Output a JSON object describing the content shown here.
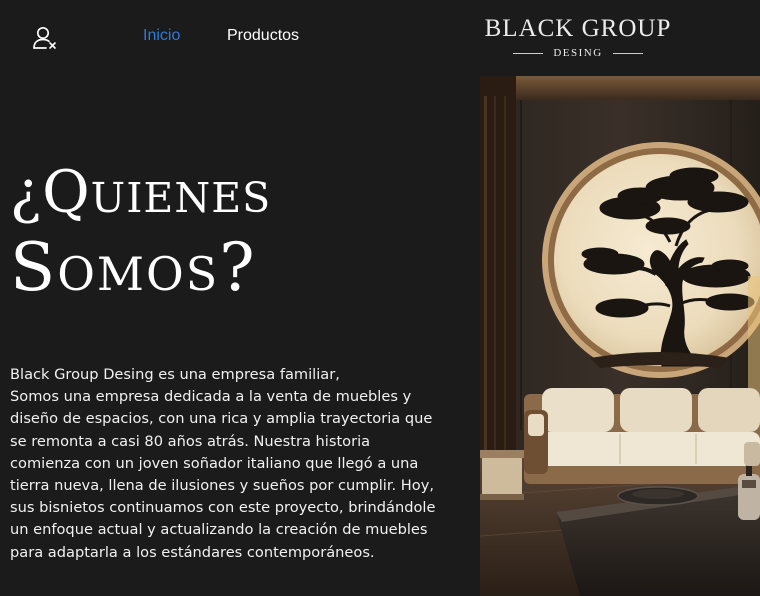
{
  "header": {
    "user_icon": "user-remove-icon",
    "nav": [
      {
        "label": "Inicio",
        "active": true,
        "color": "#2e7bd6"
      },
      {
        "label": "Productos",
        "active": false,
        "color": "#ffffff"
      }
    ],
    "logo": {
      "main": "BLACK GROUP",
      "sub": "DESING"
    }
  },
  "main": {
    "heading": {
      "line1": "¿Quienes",
      "line2": "Somos?"
    },
    "paragraph_lines": [
      "Black Group Desing es una empresa familiar,",
      "Somos una empresa dedicada a la venta de muebles y",
      "diseño de espacios, con una rica y amplia trayectoria que",
      "se remonta a casi 80 años atrás. Nuestra historia",
      "comienza con un joven soñador italiano que llegó a una",
      "tierra nueva, llena de ilusiones y sueños por cumplir. Hoy,",
      "sus bisnietos continuamos con este proyecto, brindándole",
      "un enfoque actual y actualizando la creación de muebles",
      "para adaptarla a los estándares contemporáneos."
    ],
    "hero_image": {
      "subject": "interior-living-room-with-round-bonsai-tree-window-and-sofa"
    }
  },
  "colors": {
    "background": "#1b1b1c",
    "text": "#ffffff",
    "accent": "#2e7bd6"
  }
}
